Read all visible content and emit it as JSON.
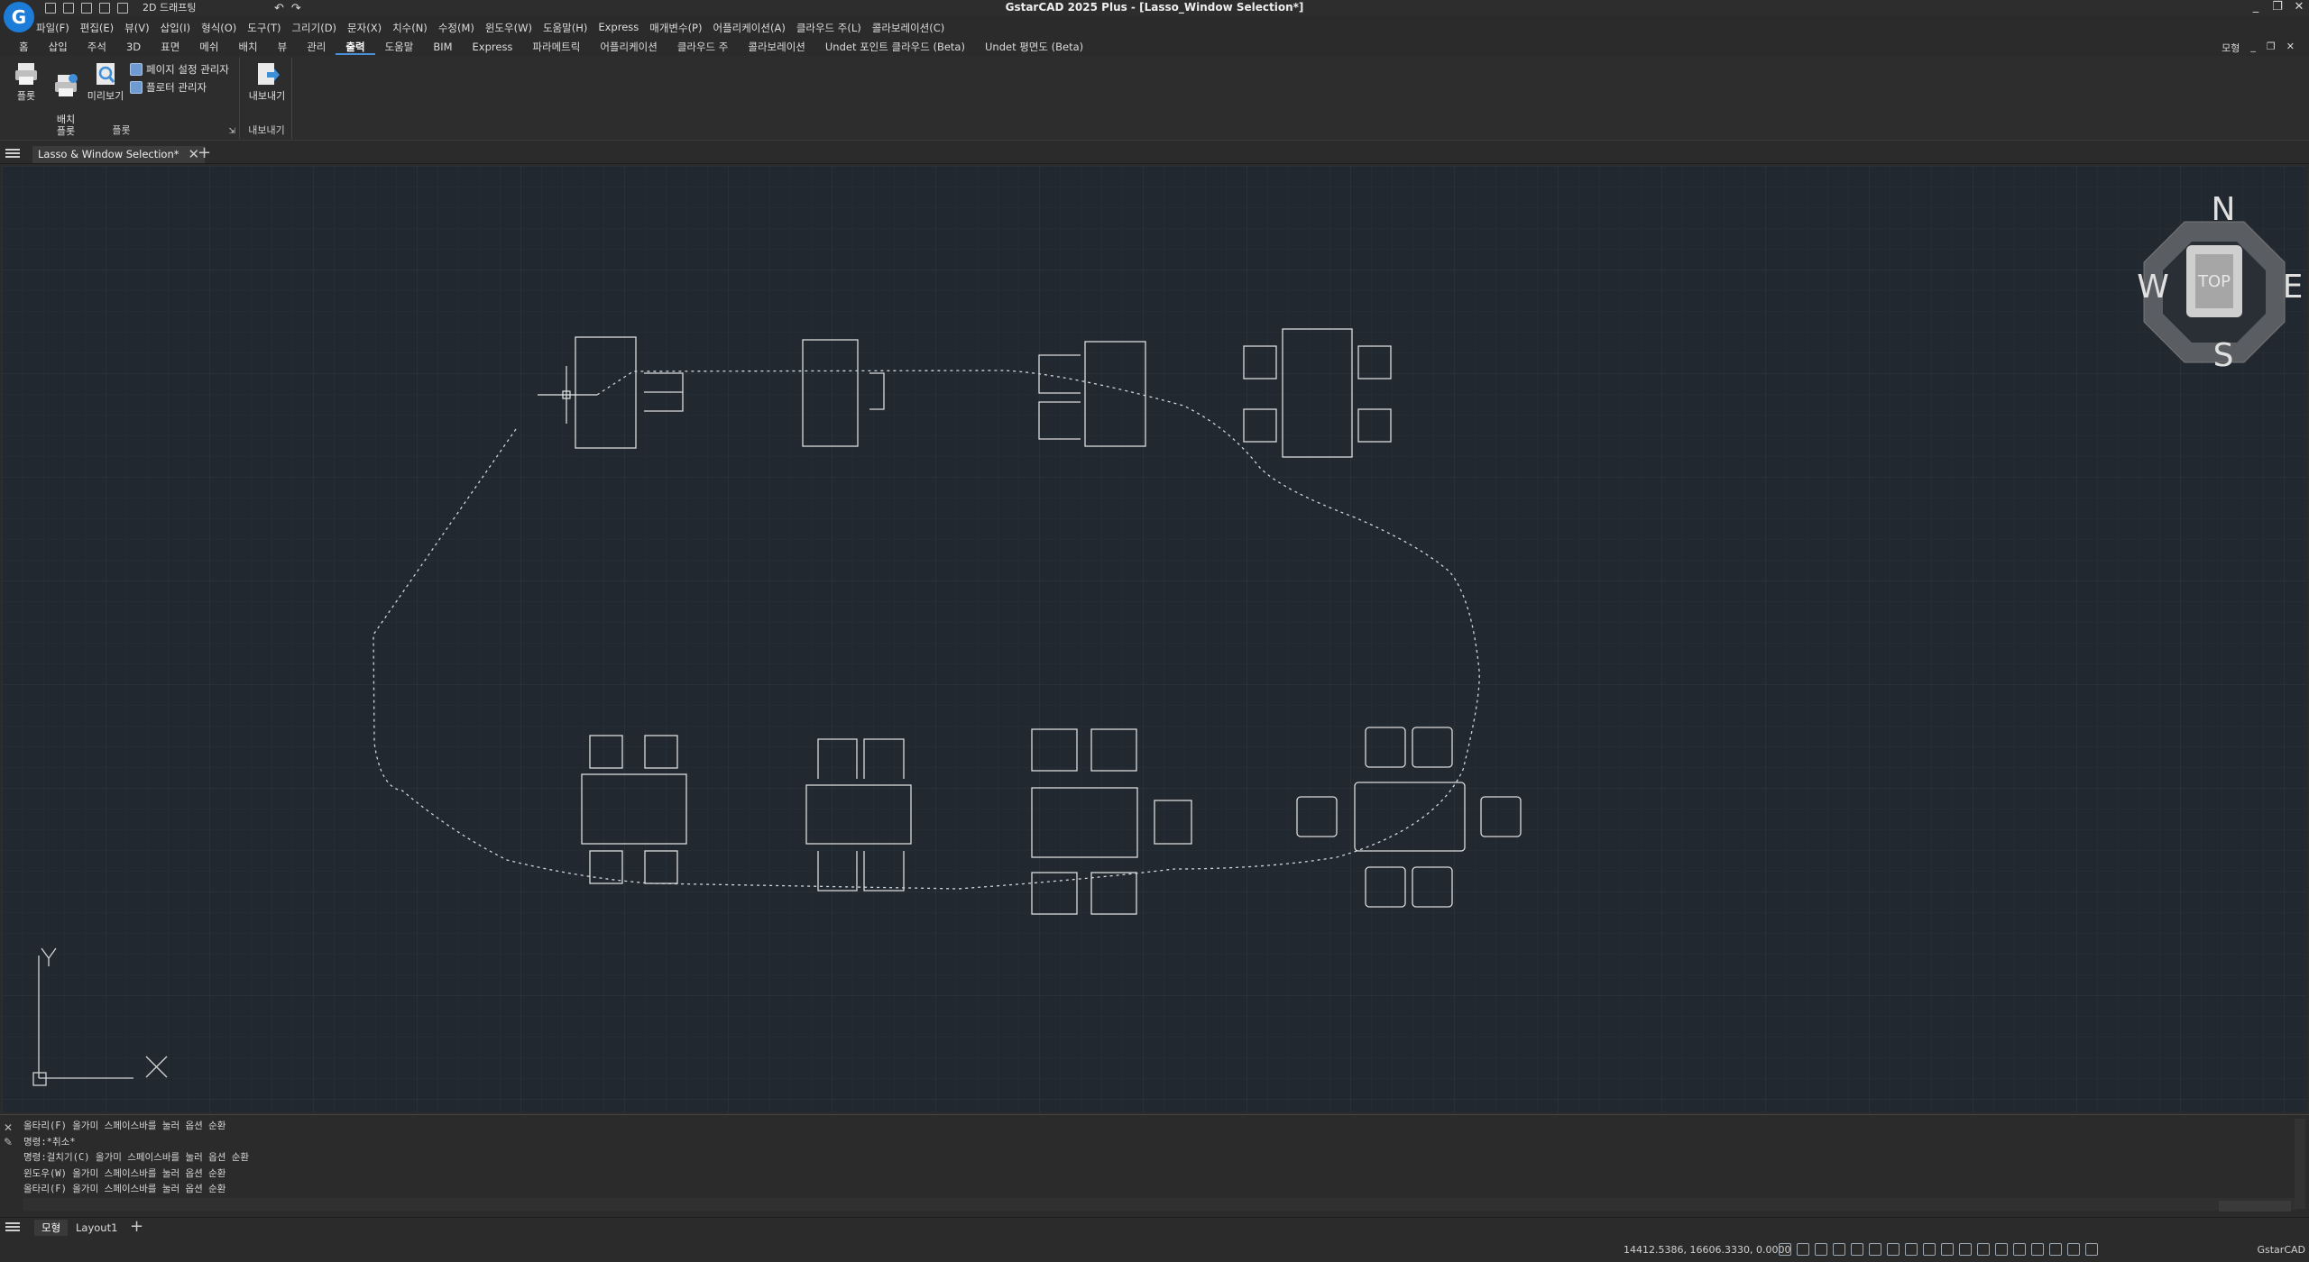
{
  "app": {
    "logo_letter": "G",
    "title": "GstarCAD 2025 Plus - [Lasso_Window Selection*]",
    "workspace": "2D 드래프팅"
  },
  "window_controls": [
    "_",
    "❐",
    "✕"
  ],
  "menus": [
    "파일(F)",
    "편집(E)",
    "뷰(V)",
    "삽입(I)",
    "형식(O)",
    "도구(T)",
    "그리기(D)",
    "문자(X)",
    "치수(N)",
    "수정(M)",
    "윈도우(W)",
    "도움말(H)",
    "Express",
    "매개변수(P)",
    "어플리케이션(A)",
    "클라우드 주(L)",
    "콜라보레이션(C)"
  ],
  "ribbon_tabs": [
    {
      "label": "홈",
      "active": false
    },
    {
      "label": "삽입",
      "active": false
    },
    {
      "label": "주석",
      "active": false
    },
    {
      "label": "3D",
      "active": false
    },
    {
      "label": "표면",
      "active": false
    },
    {
      "label": "메쉬",
      "active": false
    },
    {
      "label": "배치",
      "active": false
    },
    {
      "label": "뷰",
      "active": false
    },
    {
      "label": "관리",
      "active": false
    },
    {
      "label": "출력",
      "active": true
    },
    {
      "label": "도움말",
      "active": false
    },
    {
      "label": "BIM",
      "active": false
    },
    {
      "label": "Express",
      "active": false
    },
    {
      "label": "파라메트릭",
      "active": false
    },
    {
      "label": "어플리케이션",
      "active": false
    },
    {
      "label": "클라우드 주",
      "active": false
    },
    {
      "label": "콜라보레이션",
      "active": false
    },
    {
      "label": "Undet 포인트 클라우드 (Beta)",
      "active": false
    },
    {
      "label": "Undet 평면도 (Beta)",
      "active": false
    }
  ],
  "ribbon_right": {
    "label": "모형",
    "controls": [
      "_",
      "❐",
      "✕"
    ]
  },
  "ribbon": {
    "plot_panel": {
      "label": "플롯",
      "plot": "플롯",
      "batch_plot": "배치\n플롯",
      "preview": "미리보기",
      "page_setup": "페이지 설정 관리자",
      "plotter_manager": "플로터 관리자"
    },
    "export_panel": {
      "label": "내보내기",
      "export": "내보내기"
    }
  },
  "document_tab": {
    "title": "Lasso & Window Selection*"
  },
  "viewcube": {
    "face": "TOP",
    "n": "N",
    "s": "S",
    "e": "E",
    "w": "W"
  },
  "ucs": {
    "x": "X",
    "y": "Y"
  },
  "command_lines": [
    "올타리(F)  올가미    스페이스바를 눌러 옵션 순환",
    "명령:*취소*",
    "명령:걸치기(C) 올가미    스페이스바를 눌러 옵션 순환",
    "윈도우(W) 올가미    스페이스바를 눌러 옵션 순환",
    "올타리(F)  올가미    스페이스바를 눌러 옵션 순환"
  ],
  "layout_tabs": [
    {
      "label": "모형",
      "active": true
    },
    {
      "label": "Layout1",
      "active": false
    }
  ],
  "status": {
    "coordinates": "14412.5386, 16606.3330, 0.0000",
    "brand": "GstarCAD"
  },
  "colors": {
    "canvas": "#212830",
    "entity": "#dcdcdc",
    "accent": "#4a90d9"
  }
}
